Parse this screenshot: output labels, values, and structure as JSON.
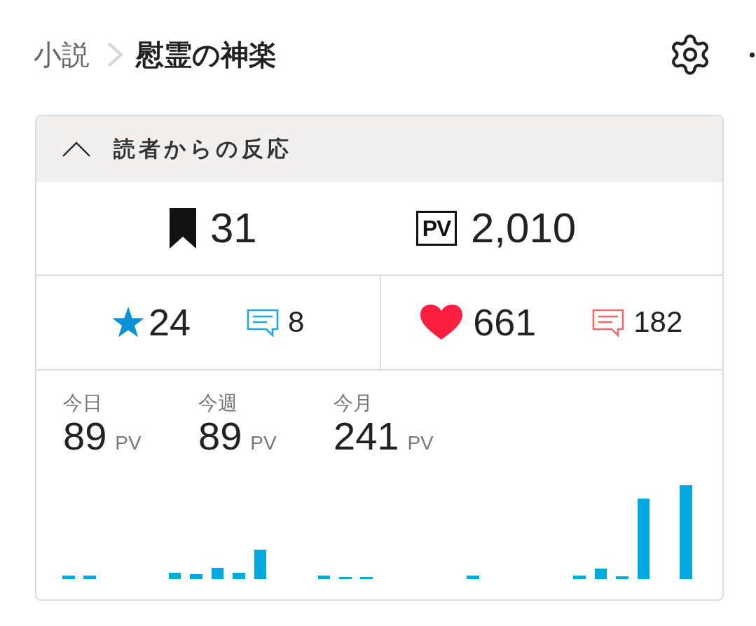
{
  "breadcrumb": {
    "parent": "小説",
    "current": "慰霊の神楽"
  },
  "panel": {
    "title": "読者からの反応",
    "expanded": true,
    "totals": [
      {
        "kind": "bookmark",
        "value": "31"
      },
      {
        "kind": "page_views",
        "badge": "PV",
        "value": "2,010"
      }
    ],
    "reactions": [
      {
        "kind": "star",
        "color": "#0b93d5",
        "value": "24",
        "comments": {
          "color": "#1ea7df",
          "count": "8"
        }
      },
      {
        "kind": "heart",
        "color": "#fe1f40",
        "value": "661",
        "comments": {
          "color": "#ef6b6b",
          "count": "182"
        }
      }
    ],
    "periods": [
      {
        "label": "今日",
        "value": "89",
        "unit": "PV"
      },
      {
        "label": "今週",
        "value": "89",
        "unit": "PV"
      },
      {
        "label": "今月",
        "value": "241",
        "unit": "PV"
      }
    ]
  }
}
